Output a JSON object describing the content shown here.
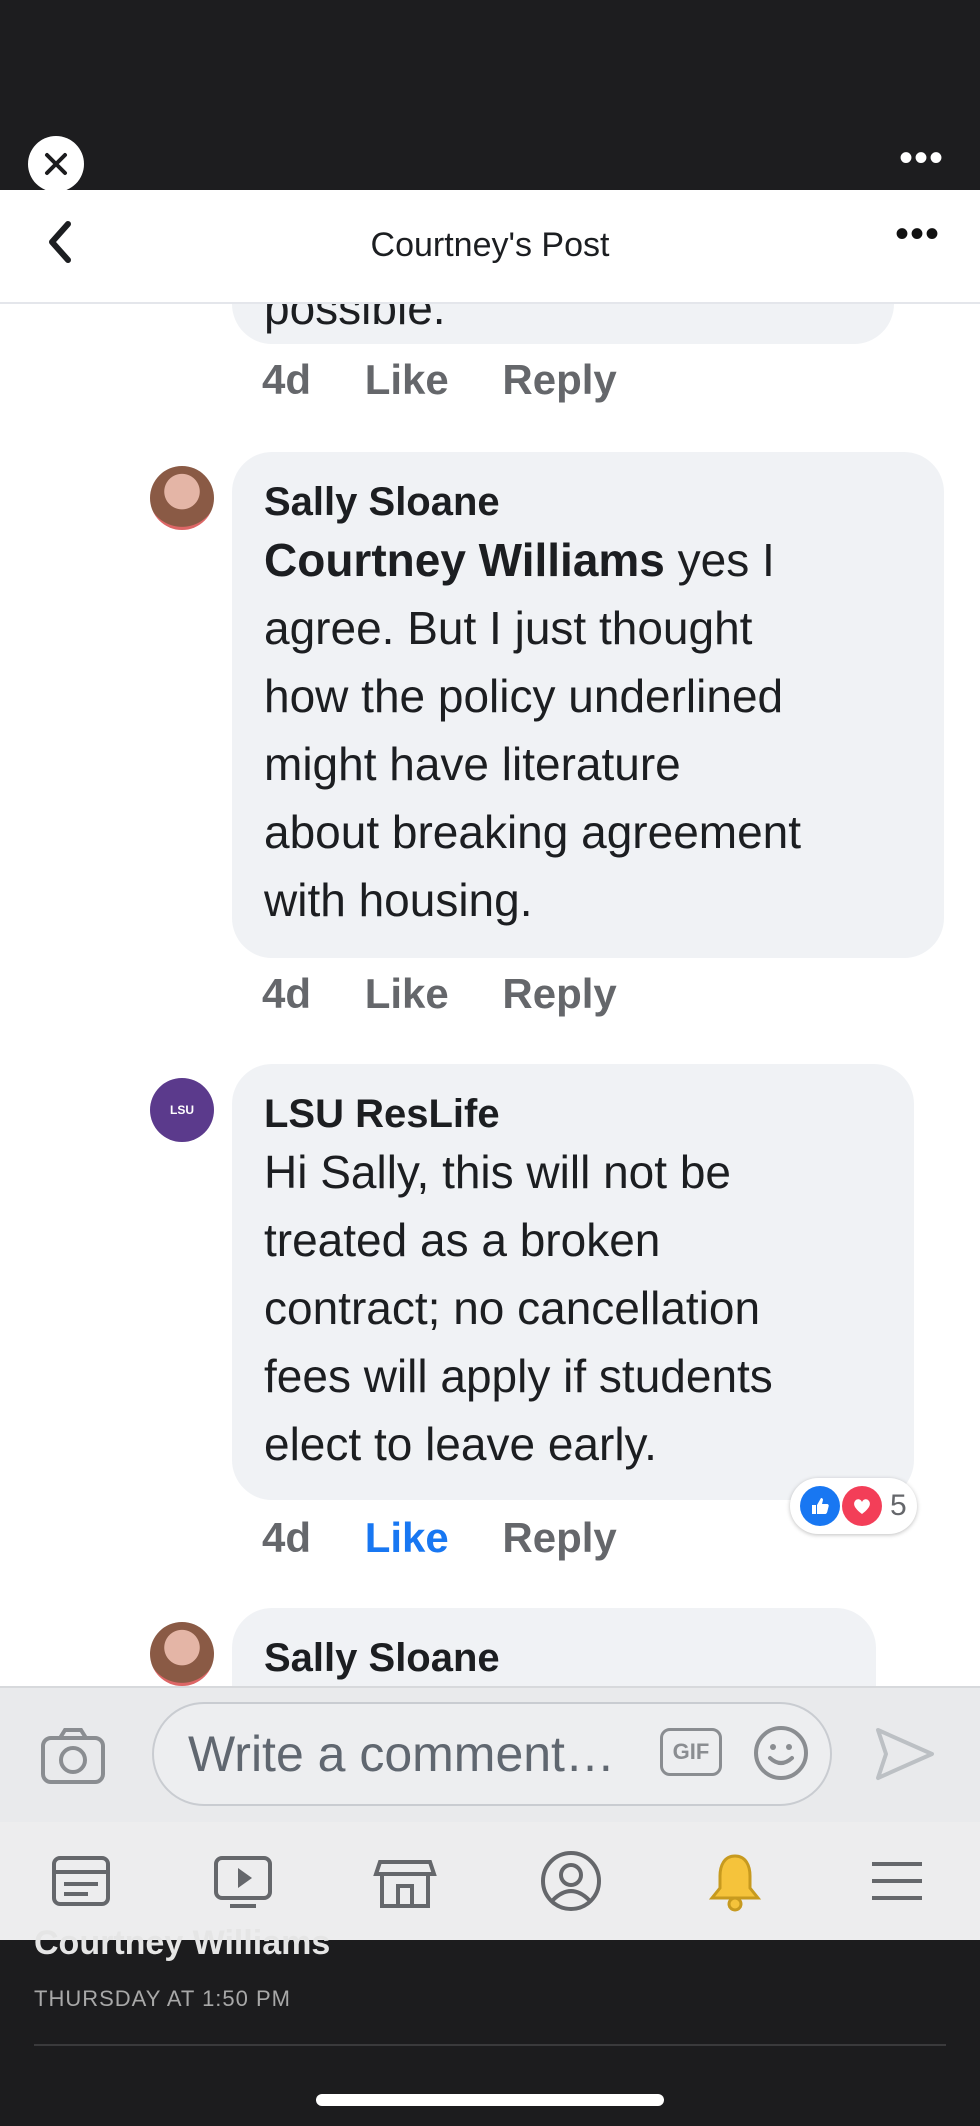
{
  "post_header": {
    "title": "Courtney's Post"
  },
  "feed": {
    "prev_comment": {
      "partial_text": "possible.",
      "time": "4d",
      "like": "Like",
      "reply": "Reply"
    },
    "comments": [
      {
        "author": "Sally Sloane",
        "mention": "Courtney Williams",
        "text_lines": [
          "yes I",
          "agree. But I just thought",
          "how the policy underlined",
          "might have literature",
          "about breaking agreement",
          "with housing."
        ],
        "time": "4d",
        "like": "Like",
        "reply": "Reply"
      },
      {
        "author": "LSU ResLife",
        "avatar_label": "LSU",
        "text_lines": [
          "Hi Sally, this will not be",
          "treated as a broken",
          "contract; no cancellation",
          "fees will apply if students",
          "elect to leave early."
        ],
        "time": "4d",
        "like": "Like",
        "reply": "Reply",
        "reaction_count": "5"
      },
      {
        "author": "Sally Sloane"
      }
    ]
  },
  "composer": {
    "placeholder": "Write a comment…",
    "gif_label": "GIF"
  },
  "overlay": {
    "author": "Courtney Williams",
    "timestamp": "THURSDAY AT 1:50 PM"
  },
  "colors": {
    "accent": "#1877f2",
    "love": "#f33e58",
    "bell": "#f5c33b"
  }
}
